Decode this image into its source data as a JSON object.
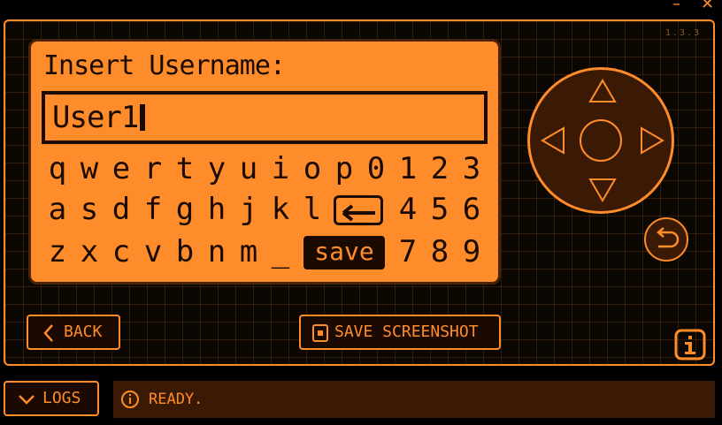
{
  "window": {
    "minimize_label": "–",
    "close_label": "✕"
  },
  "version": "1.3.3",
  "screen": {
    "prompt": "Insert Username:",
    "username_value": "User1",
    "keyboard": {
      "row1": [
        "q",
        "w",
        "e",
        "r",
        "t",
        "y",
        "u",
        "i",
        "o",
        "p",
        "0",
        "1",
        "2",
        "3"
      ],
      "row2": [
        "a",
        "s",
        "d",
        "f",
        "g",
        "h",
        "j",
        "k",
        "l",
        "4",
        "5",
        "6"
      ],
      "row3": [
        "z",
        "x",
        "c",
        "v",
        "b",
        "n",
        "m",
        "_",
        "7",
        "8",
        "9"
      ],
      "save_label": "save"
    }
  },
  "controls": {
    "back_label": "BACK",
    "screenshot_label": "SAVE SCREENSHOT",
    "logs_label": "LOGS",
    "status_text": "READY."
  },
  "colors": {
    "accent": "#ff8c2a",
    "dark": "#1a0a00",
    "panel": "#3a1a04"
  },
  "icons": [
    "up-arrow-icon",
    "down-arrow-icon",
    "left-arrow-icon",
    "right-arrow-icon",
    "undo-icon",
    "info-icon",
    "chevron-left-icon",
    "screenshot-icon",
    "chevron-down-icon",
    "backspace-icon"
  ]
}
